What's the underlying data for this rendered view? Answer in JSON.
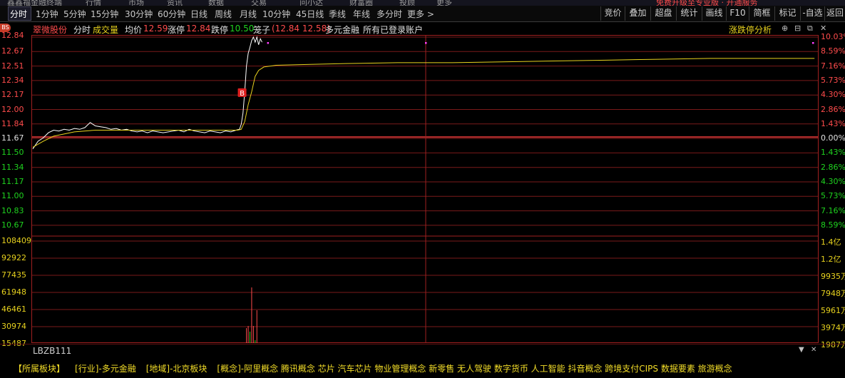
{
  "top_strip": [
    "鑫鑫福金融终端",
    "行情",
    "市场",
    "资讯",
    "数据",
    "交易",
    "问小达",
    "财富圈",
    "投顾",
    "更多",
    "免费升级至专业版 · 开通服务"
  ],
  "timeframes": [
    "分时",
    "1分钟",
    "5分钟",
    "15分钟",
    "30分钟",
    "60分钟",
    "日线",
    "周线",
    "月线",
    "10分钟",
    "45日线",
    "季线",
    "年线",
    "多分时",
    "更多 >"
  ],
  "right_buttons": [
    "竞价",
    "叠加",
    "超盘",
    "统计",
    "画线",
    "F10",
    "简框",
    "标记",
    "-自选",
    "返回"
  ],
  "info": {
    "bs": "BS",
    "name": "翠微股份",
    "mode": "分时",
    "volume": "成交量",
    "avg_label": "均价",
    "avg_value": "12.59",
    "limit_up_label": "涨停",
    "limit_up_value": "12.84",
    "limit_down_label": "跌停",
    "limit_down_value": "10.50",
    "overlay_label": "笼子",
    "overlay_value": "(12.84 12.58)",
    "sector": "多元金融",
    "accounts": "所有已登录账户",
    "analysis": "涨跌停分析"
  },
  "price_axis": [
    "12.84",
    "12.67",
    "12.51",
    "12.34",
    "12.17",
    "12.00",
    "11.84",
    "11.67",
    "11.50",
    "11.34",
    "11.17",
    "11.00",
    "10.83",
    "10.67"
  ],
  "pct_axis": [
    "10.03%",
    "8.59%",
    "7.16%",
    "5.73%",
    "4.30%",
    "2.86%",
    "1.43%",
    "0.00%",
    "1.43%",
    "2.86%",
    "4.30%",
    "5.73%",
    "7.16%",
    "8.59%"
  ],
  "vol_axis_left": [
    "108409",
    "92922",
    "77435",
    "61948",
    "46461",
    "30974",
    "15487"
  ],
  "vol_axis_right": [
    "1.4亿",
    "1.2亿",
    "9935万",
    "7948万",
    "5961万",
    "3974万",
    "1987万"
  ],
  "buy_marker": "B",
  "colors": {
    "up": "#ff4c4c",
    "down": "#1fd31f",
    "price_line": "#ffffff",
    "avg_line": "#e8d21e",
    "grid": "#7a1a1a"
  },
  "chart_data": {
    "type": "line",
    "x_label": "",
    "ylim": [
      10.5,
      12.84
    ],
    "prev_close": 11.67,
    "series": [
      {
        "key": "price",
        "values": [
          [
            0,
            11.53
          ],
          [
            6,
            11.62
          ],
          [
            12,
            11.66
          ],
          [
            18,
            11.72
          ],
          [
            24,
            11.75
          ],
          [
            30,
            11.74
          ],
          [
            36,
            11.76
          ],
          [
            42,
            11.75
          ],
          [
            48,
            11.77
          ],
          [
            54,
            11.76
          ],
          [
            60,
            11.78
          ],
          [
            66,
            11.84
          ],
          [
            72,
            11.8
          ],
          [
            78,
            11.79
          ],
          [
            84,
            11.78
          ],
          [
            90,
            11.76
          ],
          [
            96,
            11.77
          ],
          [
            102,
            11.75
          ],
          [
            108,
            11.76
          ],
          [
            114,
            11.74
          ],
          [
            120,
            11.73
          ],
          [
            126,
            11.74
          ],
          [
            132,
            11.72
          ],
          [
            138,
            11.74
          ],
          [
            144,
            11.73
          ],
          [
            150,
            11.72
          ],
          [
            156,
            11.73
          ],
          [
            162,
            11.74
          ],
          [
            168,
            11.75
          ],
          [
            174,
            11.73
          ],
          [
            180,
            11.76
          ],
          [
            186,
            11.74
          ],
          [
            192,
            11.73
          ],
          [
            198,
            11.72
          ],
          [
            204,
            11.74
          ],
          [
            210,
            11.73
          ],
          [
            216,
            11.72
          ],
          [
            222,
            11.74
          ],
          [
            228,
            11.73
          ],
          [
            234,
            11.75
          ],
          [
            238,
            11.76
          ],
          [
            240,
            11.82
          ],
          [
            242,
            11.95
          ],
          [
            244,
            12.2
          ],
          [
            246,
            12.5
          ],
          [
            248,
            12.65
          ],
          [
            250,
            12.72
          ],
          [
            252,
            12.8
          ],
          [
            254,
            12.84
          ],
          [
            256,
            12.78
          ],
          [
            258,
            12.84
          ],
          [
            260,
            12.75
          ],
          [
            262,
            12.82
          ],
          [
            264,
            12.78
          ]
        ]
      },
      {
        "key": "avg",
        "values": [
          [
            0,
            11.55
          ],
          [
            12,
            11.62
          ],
          [
            24,
            11.68
          ],
          [
            48,
            11.73
          ],
          [
            72,
            11.75
          ],
          [
            96,
            11.75
          ],
          [
            120,
            11.75
          ],
          [
            144,
            11.75
          ],
          [
            168,
            11.75
          ],
          [
            192,
            11.75
          ],
          [
            216,
            11.75
          ],
          [
            236,
            11.75
          ],
          [
            240,
            11.76
          ],
          [
            244,
            11.85
          ],
          [
            248,
            12.05
          ],
          [
            252,
            12.2
          ],
          [
            256,
            12.38
          ],
          [
            260,
            12.45
          ],
          [
            266,
            12.49
          ],
          [
            280,
            12.51
          ],
          [
            320,
            12.52
          ],
          [
            360,
            12.53
          ],
          [
            420,
            12.54
          ],
          [
            480,
            12.54
          ],
          [
            540,
            12.55
          ],
          [
            600,
            12.56
          ],
          [
            660,
            12.57
          ],
          [
            720,
            12.58
          ],
          [
            780,
            12.59
          ],
          [
            840,
            12.59
          ],
          [
            900,
            12.59
          ]
        ]
      }
    ],
    "volume": [
      [
        0,
        2
      ],
      [
        6,
        2
      ],
      [
        12,
        3
      ],
      [
        18,
        2
      ],
      [
        24,
        3
      ],
      [
        30,
        2
      ],
      [
        36,
        2
      ],
      [
        42,
        3
      ],
      [
        48,
        2
      ],
      [
        54,
        3
      ],
      [
        60,
        2
      ],
      [
        66,
        2
      ],
      [
        72,
        13
      ],
      [
        78,
        4
      ],
      [
        84,
        3
      ],
      [
        90,
        2
      ],
      [
        96,
        3
      ],
      [
        102,
        2
      ],
      [
        108,
        3
      ],
      [
        114,
        2
      ],
      [
        120,
        2
      ],
      [
        126,
        3
      ],
      [
        132,
        2
      ],
      [
        138,
        3
      ],
      [
        144,
        2
      ],
      [
        150,
        2
      ],
      [
        156,
        3
      ],
      [
        162,
        2
      ],
      [
        168,
        2
      ],
      [
        174,
        3
      ],
      [
        180,
        2
      ],
      [
        186,
        2
      ],
      [
        192,
        3
      ],
      [
        198,
        2
      ],
      [
        204,
        3
      ],
      [
        210,
        2
      ],
      [
        216,
        2
      ],
      [
        222,
        3
      ],
      [
        228,
        2
      ],
      [
        234,
        2
      ],
      [
        238,
        2
      ],
      [
        242,
        4
      ],
      [
        246,
        45
      ],
      [
        248,
        48
      ],
      [
        250,
        40
      ],
      [
        252,
        102
      ],
      [
        254,
        48
      ],
      [
        256,
        28
      ],
      [
        258,
        70
      ],
      [
        260,
        9
      ],
      [
        264,
        10
      ],
      [
        268,
        7
      ],
      [
        272,
        8
      ],
      [
        276,
        6
      ],
      [
        280,
        7
      ],
      [
        284,
        6
      ],
      [
        288,
        5
      ],
      [
        292,
        6
      ],
      [
        296,
        5
      ],
      [
        300,
        5
      ],
      [
        306,
        7
      ],
      [
        312,
        4
      ],
      [
        318,
        4
      ],
      [
        324,
        3
      ],
      [
        330,
        4
      ],
      [
        336,
        3
      ],
      [
        342,
        3
      ],
      [
        348,
        3
      ],
      [
        354,
        2
      ],
      [
        360,
        3
      ],
      [
        366,
        2
      ],
      [
        372,
        2
      ],
      [
        378,
        2
      ],
      [
        384,
        2
      ],
      [
        390,
        2
      ],
      [
        396,
        2
      ],
      [
        402,
        2
      ],
      [
        408,
        2
      ],
      [
        414,
        2
      ],
      [
        420,
        2
      ],
      [
        426,
        2
      ],
      [
        432,
        3
      ],
      [
        438,
        2
      ],
      [
        444,
        2
      ],
      [
        450,
        2
      ],
      [
        456,
        2
      ],
      [
        462,
        2
      ],
      [
        468,
        2
      ],
      [
        474,
        2
      ],
      [
        480,
        2
      ],
      [
        486,
        2
      ],
      [
        492,
        2
      ],
      [
        498,
        2
      ],
      [
        504,
        2
      ],
      [
        510,
        2
      ],
      [
        516,
        2
      ],
      [
        522,
        2
      ],
      [
        528,
        2
      ],
      [
        534,
        2
      ],
      [
        540,
        2
      ],
      [
        546,
        2
      ],
      [
        552,
        2
      ],
      [
        554,
        16
      ],
      [
        558,
        2
      ],
      [
        564,
        2
      ],
      [
        570,
        2
      ],
      [
        576,
        2
      ],
      [
        582,
        2
      ],
      [
        588,
        2
      ],
      [
        594,
        2
      ],
      [
        600,
        2
      ],
      [
        606,
        2
      ],
      [
        612,
        2
      ],
      [
        618,
        2
      ],
      [
        624,
        2
      ],
      [
        630,
        2
      ],
      [
        636,
        2
      ],
      [
        642,
        2
      ],
      [
        648,
        2
      ],
      [
        654,
        2
      ],
      [
        660,
        2
      ],
      [
        666,
        2
      ],
      [
        672,
        2
      ],
      [
        678,
        2
      ],
      [
        684,
        2
      ],
      [
        690,
        2
      ],
      [
        696,
        2
      ],
      [
        702,
        2
      ],
      [
        708,
        2
      ],
      [
        714,
        2
      ],
      [
        720,
        2
      ],
      [
        726,
        2
      ],
      [
        732,
        2
      ],
      [
        738,
        2
      ],
      [
        744,
        2
      ],
      [
        750,
        2
      ],
      [
        756,
        2
      ],
      [
        762,
        2
      ],
      [
        768,
        2
      ],
      [
        774,
        2
      ],
      [
        780,
        2
      ],
      [
        786,
        2
      ],
      [
        792,
        2
      ],
      [
        798,
        2
      ],
      [
        804,
        2
      ],
      [
        810,
        2
      ],
      [
        816,
        2
      ],
      [
        822,
        2
      ],
      [
        828,
        2
      ],
      [
        834,
        2
      ],
      [
        840,
        2
      ],
      [
        846,
        2
      ],
      [
        852,
        2
      ],
      [
        858,
        2
      ],
      [
        864,
        2
      ],
      [
        870,
        2
      ],
      [
        876,
        2
      ],
      [
        882,
        2
      ],
      [
        888,
        2
      ],
      [
        894,
        2
      ],
      [
        900,
        2
      ]
    ]
  },
  "bottom": {
    "code": "LBZB111",
    "tags": [
      "【所属板块】",
      "[行业]-多元金融",
      "[地域]-北京板块",
      "[概念]-阿里概念 腾讯概念 芯片 汽车芯片 物业管理概念 新零售 无人驾驶 数字货币 人工智能 抖音概念 跨境支付CIPS 数据要素 旅游概念"
    ]
  }
}
